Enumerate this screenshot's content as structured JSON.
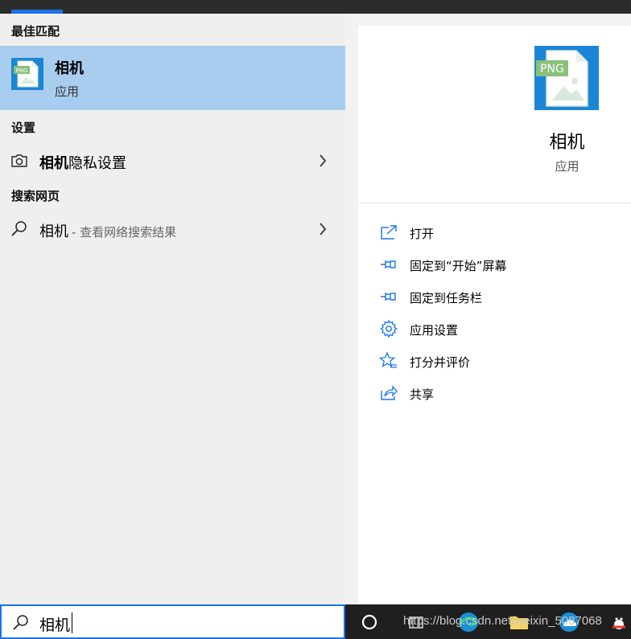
{
  "left": {
    "best_match_header": "最佳匹配",
    "best_match": {
      "name": "相机",
      "type": "应用",
      "icon": "png-file-icon",
      "highlight_color": "#a9cdee"
    },
    "settings_header": "设置",
    "settings_item": {
      "bold": "相机",
      "rest": "隐私设置",
      "icon": "camera-icon"
    },
    "web_header": "搜索网页",
    "web_item": {
      "query": "相机",
      "suffix": "- 查看网络搜索结果",
      "icon": "search-icon"
    }
  },
  "detail": {
    "name": "相机",
    "type": "应用",
    "actions": [
      {
        "label": "打开",
        "icon": "open-icon"
      },
      {
        "label": "固定到“开始”屏幕",
        "icon": "pin-icon"
      },
      {
        "label": "固定到任务栏",
        "icon": "pin-icon"
      },
      {
        "label": "应用设置",
        "icon": "gear-icon"
      },
      {
        "label": "打分并评价",
        "icon": "rate-icon"
      },
      {
        "label": "共享",
        "icon": "share-icon"
      }
    ]
  },
  "search": {
    "value": "相机",
    "icon": "search-icon"
  },
  "taskbar": {
    "watermark": "https://blog.csdn.net/weixin_5087068",
    "accent": "#1a73e8"
  }
}
